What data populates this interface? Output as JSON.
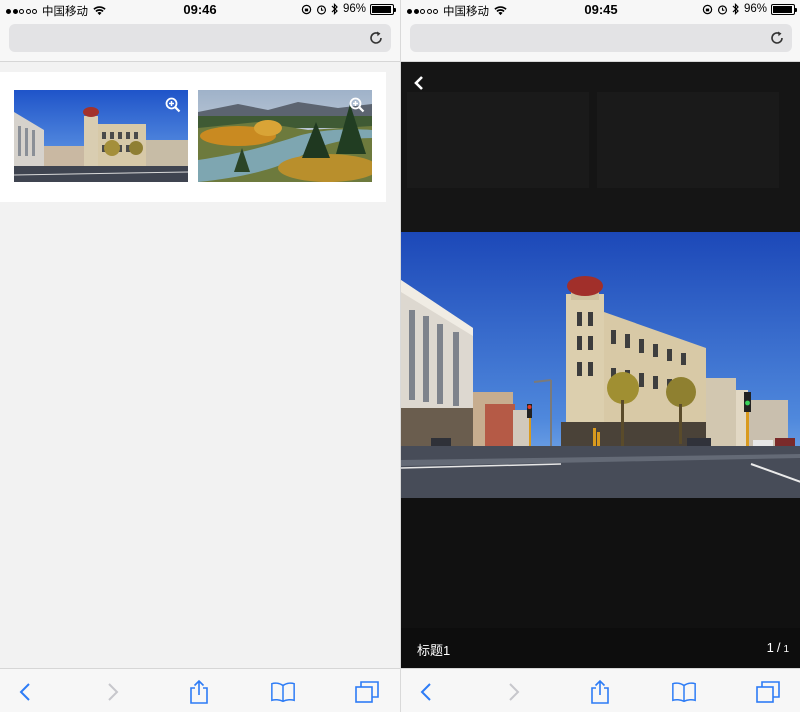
{
  "left_screen": {
    "status_bar": {
      "carrier": "中国移动",
      "time": "09:46",
      "battery": "96%",
      "battery_level": 0.96
    },
    "gallery": {
      "thumbnails": [
        {
          "icon": "zoom-in-icon"
        },
        {
          "icon": "zoom-in-icon"
        }
      ]
    }
  },
  "right_screen": {
    "status_bar": {
      "carrier": "中国移动",
      "time": "09:45",
      "battery": "96%",
      "battery_level": 0.96
    },
    "viewer": {
      "caption": "标题1",
      "current": "1",
      "separator": "/",
      "total": "1"
    }
  },
  "toolbar": {
    "icons": [
      "back-icon",
      "forward-icon",
      "share-icon",
      "bookmarks-icon",
      "tabs-icon"
    ]
  },
  "colors": {
    "ios_blue": "#2d7cf6",
    "disabled_gray": "#c7c7cc",
    "viewer_bg": "#111111"
  }
}
